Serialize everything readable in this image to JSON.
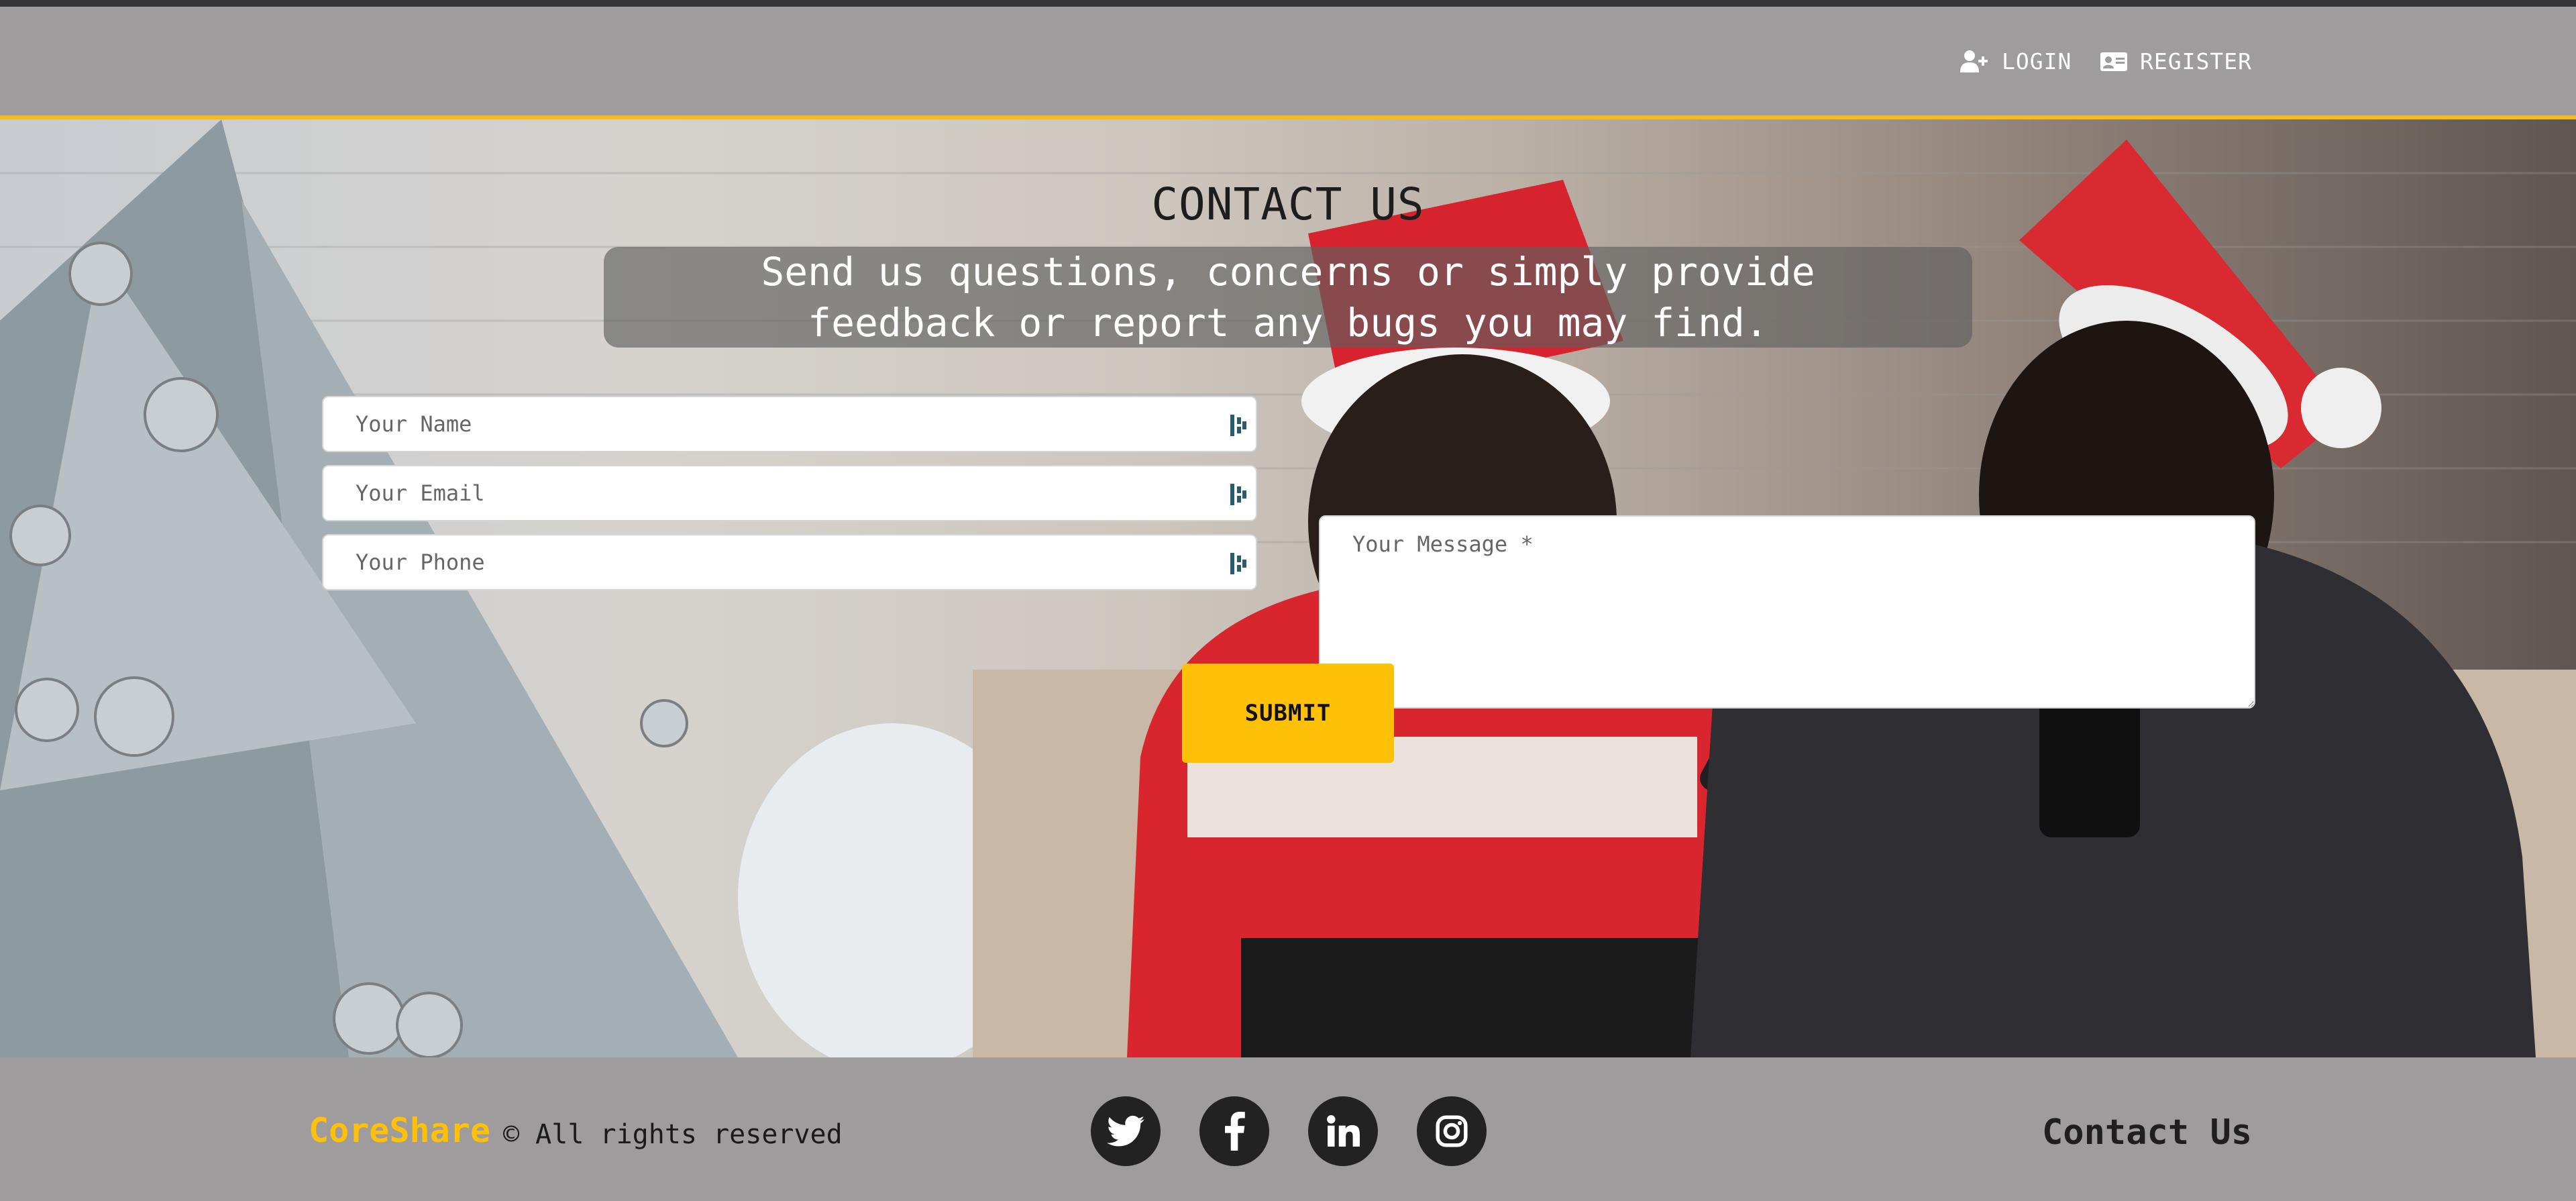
{
  "nav": {
    "login_label": "LOGIN",
    "register_label": "REGISTER",
    "login_icon": "user-plus-icon",
    "register_icon": "id-card-icon"
  },
  "hero": {
    "title": "CONTACT US",
    "subtitle_line1": "Send us questions, concerns or simply provide",
    "subtitle_line2": "feedback or report any bugs you may find."
  },
  "form": {
    "name_placeholder": "Your Name",
    "email_placeholder": "Your Email",
    "phone_placeholder": "Your Phone",
    "message_placeholder": "Your Message *",
    "submit_label": "SUBMIT",
    "field_icon": "password-manager-icon"
  },
  "footer": {
    "brand": "CoreShare",
    "rights": "© All rights reserved",
    "contact_link": "Contact Us",
    "social": [
      "twitter-icon",
      "facebook-icon",
      "linkedin-icon",
      "instagram-icon"
    ]
  },
  "colors": {
    "accent": "#ffc107",
    "header_bg": "#9e9c9d",
    "header_border": "#f2bd1d",
    "social_bg": "#222222"
  }
}
